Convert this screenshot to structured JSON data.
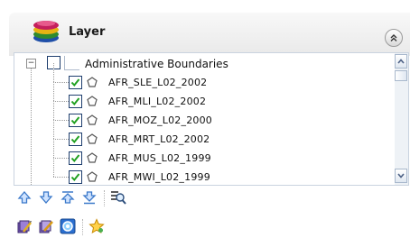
{
  "panel": {
    "title": "Layer",
    "collapse_icon": "double-chevron-up-icon"
  },
  "tree": {
    "root": {
      "label": "Administrative Boundaries",
      "checked": false,
      "expanded": true
    },
    "layers": [
      {
        "label": "AFR_SLE_L02_2002",
        "checked": true
      },
      {
        "label": "AFR_MLI_L02_2002",
        "checked": true
      },
      {
        "label": "AFR_MOZ_L02_2000",
        "checked": true
      },
      {
        "label": "AFR_MRT_L02_2002",
        "checked": true
      },
      {
        "label": "AFR_MUS_L02_1999",
        "checked": true
      },
      {
        "label": "AFR_MWI_L02_1999",
        "checked": true
      }
    ]
  },
  "toolbar_row1": [
    "move-up-icon",
    "move-down-icon",
    "move-to-top-icon",
    "move-to-bottom-icon",
    "layer-search-icon"
  ],
  "toolbar_row2": [
    "edit-layer-icon",
    "edit-group-icon",
    "layer-properties-icon",
    "favorites-star-icon"
  ],
  "colors": {
    "check": "#21a121",
    "arrow_blue": "#3a78c9",
    "header_bg": "#ececec"
  }
}
